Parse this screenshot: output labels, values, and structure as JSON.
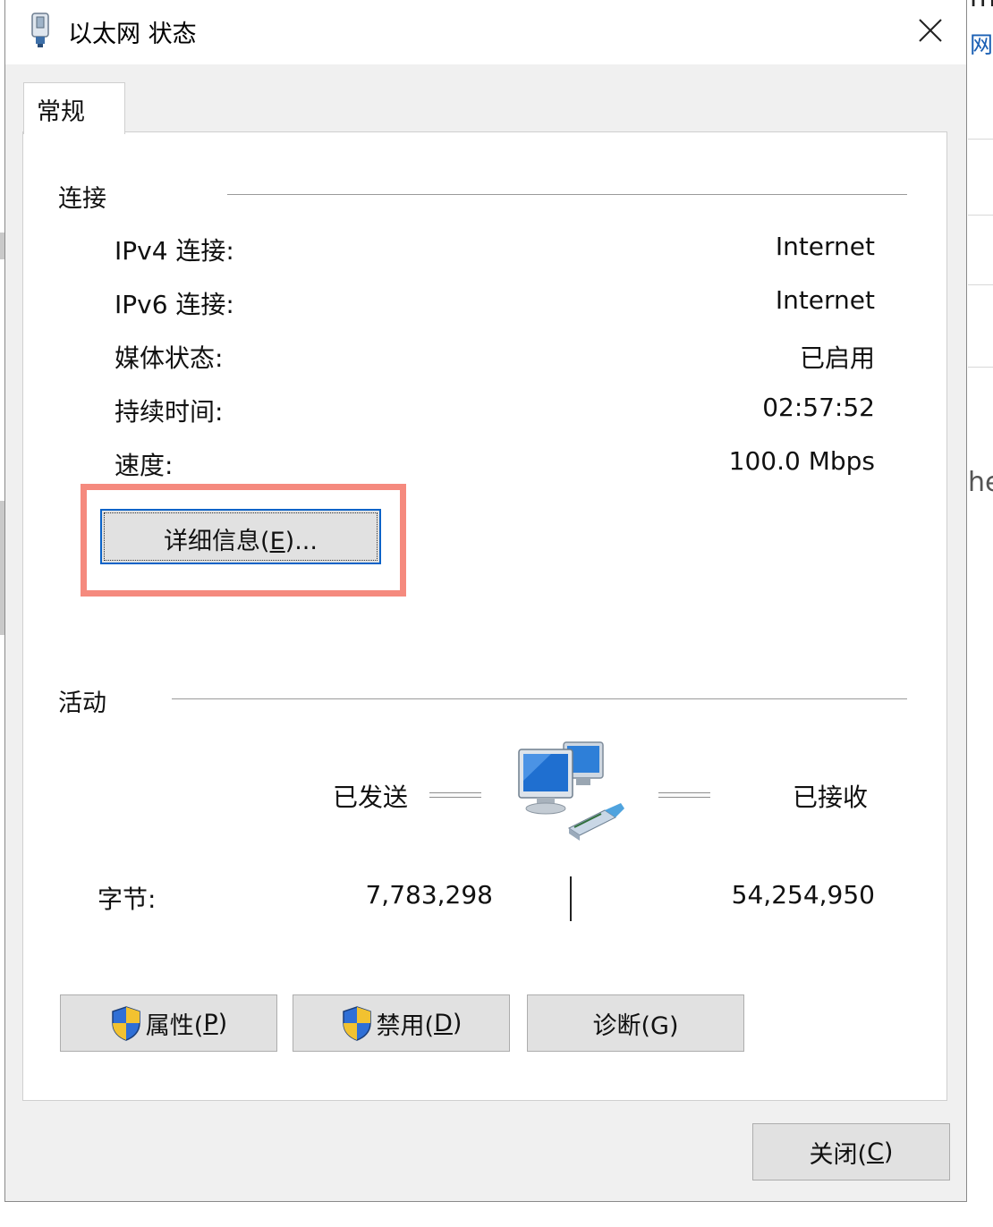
{
  "window": {
    "title": "以太网 状态",
    "close_glyph": "✕"
  },
  "tabs": [
    {
      "label": "常规"
    }
  ],
  "connection": {
    "group_label": "连接",
    "rows": [
      {
        "label": "IPv4 连接:",
        "value": "Internet"
      },
      {
        "label": "IPv6 连接:",
        "value": "Internet"
      },
      {
        "label": "媒体状态:",
        "value": "已启用"
      },
      {
        "label": "持续时间:",
        "value": "02:57:52"
      },
      {
        "label": "速度:",
        "value": "100.0 Mbps"
      }
    ],
    "details_button": {
      "text": "详细信息(",
      "mnemonic": "E",
      "suffix": ")..."
    }
  },
  "activity": {
    "group_label": "活动",
    "sent_label": "已发送",
    "received_label": "已接收",
    "bytes_label": "字节:",
    "bytes_sent": "7,783,298",
    "bytes_received": "54,254,950"
  },
  "buttons": {
    "properties": {
      "text": "属性(",
      "mnemonic": "P",
      "suffix": ")"
    },
    "disable": {
      "text": "禁用(",
      "mnemonic": "D",
      "suffix": ")"
    },
    "diagnose": {
      "text": "诊断(G)"
    },
    "close": {
      "text": "关闭(",
      "mnemonic": "C",
      "suffix": ")"
    }
  },
  "background": {
    "right_fragments": [
      "m",
      "网",
      "he"
    ]
  },
  "colors": {
    "highlight_border": "#f58a7e",
    "focus_border": "#0a63c8",
    "button_face": "#e1e1e1",
    "dialog_bg": "#f0f0f0"
  }
}
